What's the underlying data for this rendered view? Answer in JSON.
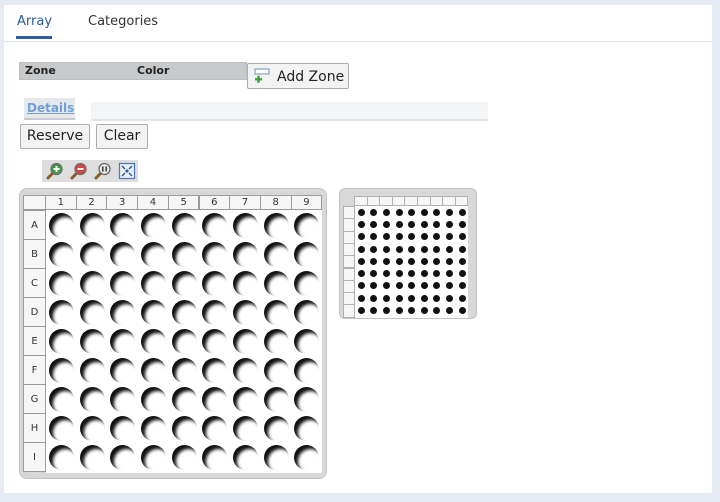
{
  "tabs": [
    {
      "label": "Array",
      "active": true
    },
    {
      "label": "Categories",
      "active": false
    }
  ],
  "zone_table": {
    "columns": [
      "Zone",
      "Color"
    ]
  },
  "add_zone_label": "Add Zone",
  "details_tab_label": "Details",
  "actions": {
    "reserve_label": "Reserve",
    "clear_label": "Clear"
  },
  "zoom_icons": [
    "zoom-in-icon",
    "zoom-out-icon",
    "zoom-reset-icon",
    "fit-to-screen-icon"
  ],
  "plate_main": {
    "columns": [
      "1",
      "2",
      "3",
      "4",
      "5",
      "6",
      "7",
      "8",
      "9"
    ],
    "rows": [
      "A",
      "B",
      "C",
      "D",
      "E",
      "F",
      "G",
      "H",
      "I"
    ]
  },
  "plate_overview": {
    "cols": 9,
    "rows": 9
  },
  "colors": {
    "accent": "#2f5e9d",
    "details_link": "#6fa0d6",
    "plate_bg": "#d8d8d8"
  }
}
